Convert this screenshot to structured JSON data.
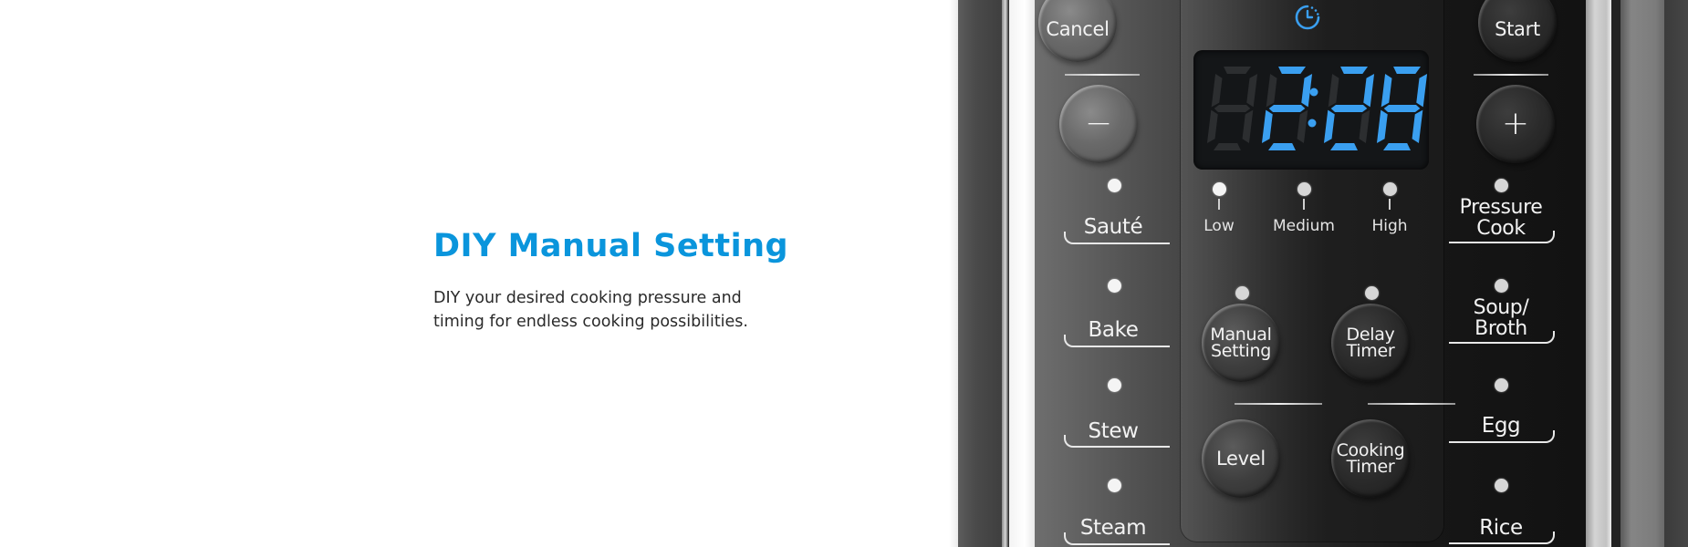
{
  "feature": {
    "title": "DIY Manual Setting",
    "description_lines": [
      "DIY your desired cooking pressure and",
      "timing for endless cooking possibilities."
    ],
    "accent_color": "#0a95dc"
  },
  "control_panel": {
    "display": {
      "value": "2:28",
      "digit_color": "#3a9ff0",
      "timer_icon": "clock-icon"
    },
    "buttons": {
      "cancel": "Cancel",
      "start": "Start",
      "minus": "−",
      "plus": "+",
      "manual_setting": [
        "Manual",
        "Setting"
      ],
      "delay_timer": [
        "Delay",
        "Timer"
      ],
      "level": "Level",
      "cooking_timer": [
        "Cooking",
        "Timer"
      ]
    },
    "pressure_levels": [
      {
        "label": "Low"
      },
      {
        "label": "Medium"
      },
      {
        "label": "High"
      }
    ],
    "left_modes": [
      {
        "label": "Sauté"
      },
      {
        "label": "Bake"
      },
      {
        "label": "Stew"
      },
      {
        "label": "Steam"
      }
    ],
    "right_modes": [
      {
        "label": [
          "Pressure",
          "Cook"
        ]
      },
      {
        "label": [
          "Soup/",
          "Broth"
        ]
      },
      {
        "label": "Egg"
      },
      {
        "label": "Rice"
      }
    ]
  }
}
